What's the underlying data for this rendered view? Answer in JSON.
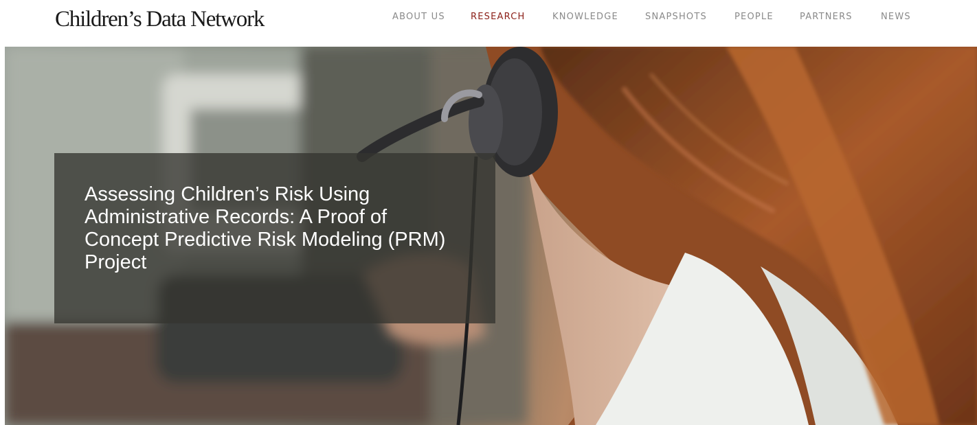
{
  "header": {
    "logo_text": "Children’s Data Network"
  },
  "nav": {
    "items": [
      {
        "label": "ABOUT US",
        "active": false
      },
      {
        "label": "RESEARCH",
        "active": true
      },
      {
        "label": "KNOWLEDGE",
        "active": false
      },
      {
        "label": "SNAPSHOTS",
        "active": false
      },
      {
        "label": "PEOPLE",
        "active": false
      },
      {
        "label": "PARTNERS",
        "active": false
      },
      {
        "label": "NEWS",
        "active": false
      }
    ],
    "active_color": "#8c2019",
    "inactive_color": "#8a8a8a"
  },
  "hero": {
    "title": "Assessing Children’s Risk Using Administrative Records: A Proof of Concept Predictive Risk Modeling (PRM) Project",
    "image_subject": "woman-with-headset-at-desk-phone"
  }
}
